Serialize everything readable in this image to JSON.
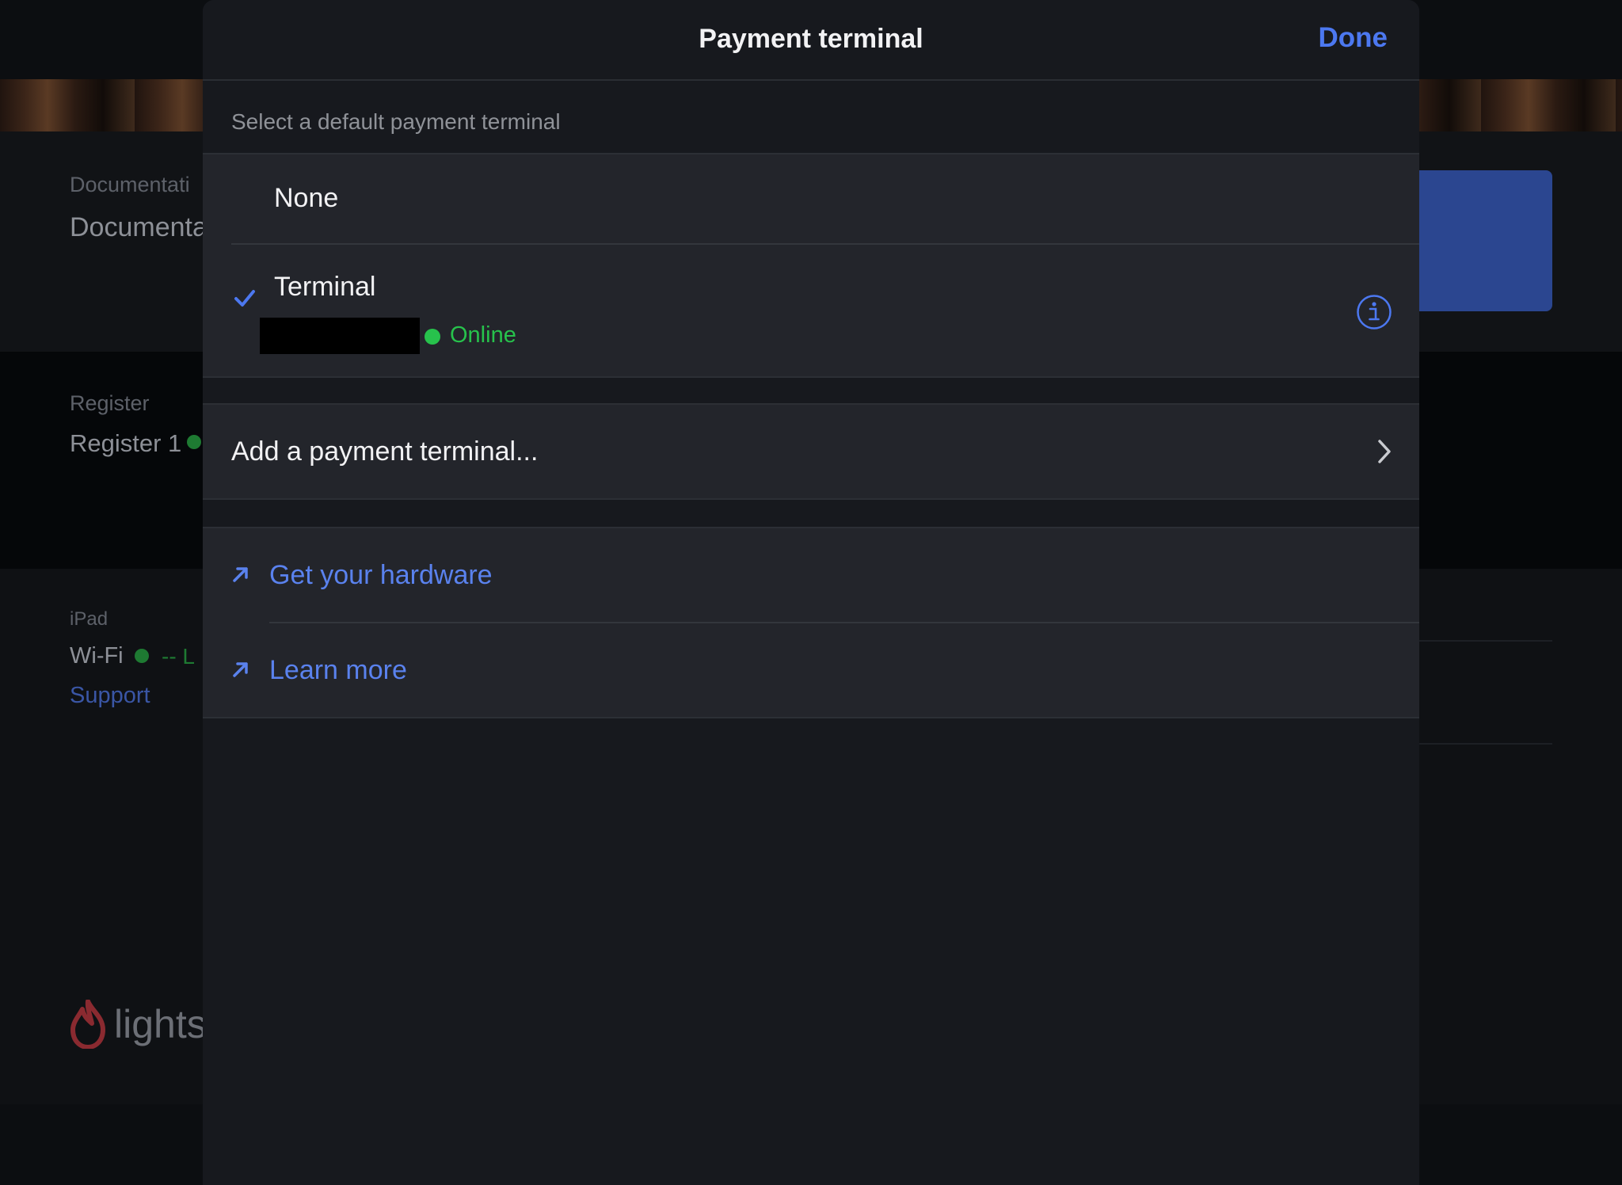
{
  "background": {
    "doc_label": "Documentati",
    "doc_value": "Documenta",
    "register_label": "Register",
    "register_value": "Register 1",
    "ipad_label": "iPad",
    "wifi_label": "Wi-Fi",
    "wifi_status": "-- L",
    "support_link": "Support",
    "logo_text": "lights"
  },
  "sheet": {
    "title": "Payment terminal",
    "done_label": "Done",
    "section_header": "Select a default payment terminal",
    "options": [
      {
        "label": "None",
        "selected": false
      },
      {
        "label": "Terminal",
        "selected": true,
        "status": "Online"
      }
    ],
    "add_terminal_label": "Add a payment terminal...",
    "links": [
      {
        "label": "Get your hardware",
        "icon": "external-link-arrow-icon"
      },
      {
        "label": "Learn more",
        "icon": "external-link-arrow-icon"
      }
    ]
  },
  "colors": {
    "accent": "#4c78f0",
    "online": "#27c24c",
    "sheet_bg": "#17191e",
    "row_bg": "#23252b"
  }
}
